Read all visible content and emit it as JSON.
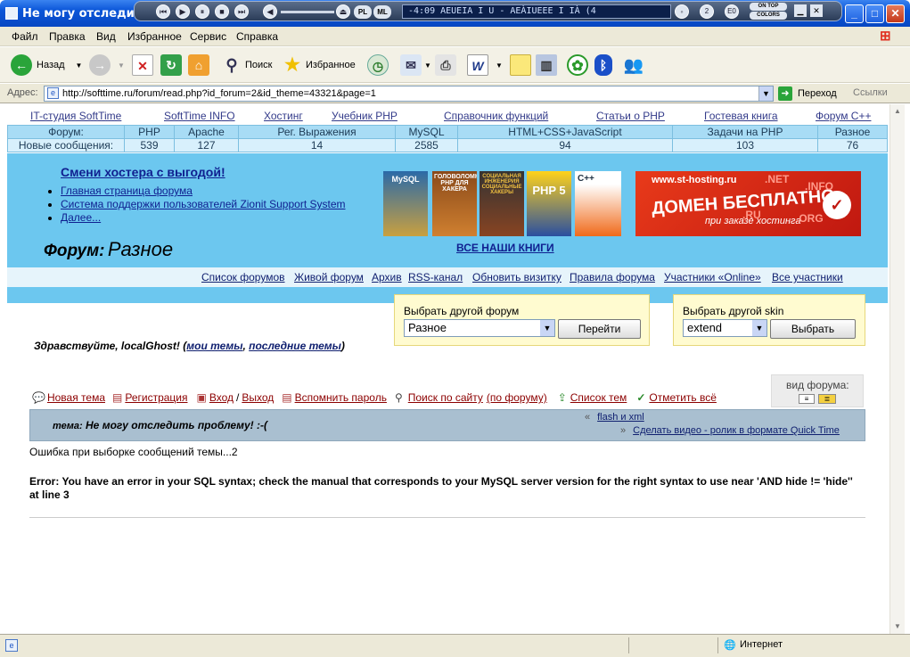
{
  "window": {
    "title": "Не могу отследить",
    "min": "_",
    "max": "□",
    "close": "✕"
  },
  "media": {
    "track": "-4:09   AEUEIA   I U -  AEÀIUEEE  I IÀ (4",
    "ontop": "ON TOP",
    "colors": "COLORS",
    "pl": "PL",
    "ml": "ML",
    "eq": "E0",
    "badge": "2"
  },
  "menu": [
    "Файл",
    "Правка",
    "Вид",
    "Избранное",
    "Сервис",
    "Справка"
  ],
  "toolbar": {
    "back": "Назад",
    "search": "Поиск",
    "favorites": "Избранное"
  },
  "address": {
    "label": "Адрес:",
    "url": "http://softtime.ru/forum/read.php?id_forum=2&id_theme=43321&page=1",
    "go": "Переход",
    "links": "Ссылки"
  },
  "toplinks": [
    "IT-студия SoftTime",
    "SoftTime INFO",
    "Хостинг",
    "Учебник PHP",
    "Справочник функций",
    "Статьи о PHP",
    "Гостевая книга",
    "Форум С++"
  ],
  "stats": {
    "headers": [
      "Форум:",
      "PHP",
      "Apache",
      "Рег. Выражения",
      "MySQL",
      "HTML+CSS+JavaScript",
      "Задачи на PHP",
      "Разное"
    ],
    "values": [
      "Новые сообщения:",
      "539",
      "127",
      "14",
      "2585",
      "94",
      "103",
      "76"
    ]
  },
  "banner": {
    "promo": "Смени хостера с выгодой!",
    "links": [
      "Главная страница форума",
      "Система поддержки пользователей Zionit Support System",
      "Далее..."
    ],
    "forum_label": "Форум:",
    "forum_name": "Разное",
    "books_link": "ВСЕ НАШИ КНИГИ",
    "books": [
      "MySQL",
      "ГОЛОВОЛОМКИ PHP ДЛЯ ХАКЕРА",
      "СОЦИАЛЬНАЯ ИНЖЕНЕРИЯ СОЦИАЛЬНЫЕ ХАКЕРЫ",
      "PHP 5",
      "C++"
    ],
    "ad_url": "www.st-hosting.ru",
    "ad_title": "ДОМЕН БЕСПЛАТНО",
    "ad_sub": "при заказе хостинга",
    "ad_tlds": [
      ".RU",
      ".NET",
      ".ORG",
      ".INFO"
    ]
  },
  "submenu": [
    "Список форумов",
    "Живой форум",
    "Архив",
    "RSS-канал",
    "Обновить визитку",
    "Правила форума",
    "Участники «Online»",
    "Все участники"
  ],
  "forum_select": {
    "label": "Выбрать другой форум",
    "value": "Разное",
    "button": "Перейти"
  },
  "skin_select": {
    "label": "Выбрать другой skin",
    "value": "extend",
    "button": "Выбрать"
  },
  "greeting": {
    "text": "Здравствуйте, localGhost!",
    "open": "(",
    "my_topics": "мои темы",
    "comma": ",",
    "last_topics": "последние темы",
    "close": ")"
  },
  "actions": {
    "new_topic": "Новая тема",
    "register": "Регистрация",
    "login": "Вход",
    "slash": "/",
    "logout": "Выход",
    "remind": "Вспомнить пароль",
    "search": "Поиск по сайту",
    "search_forum": "(по форуму)",
    "topic_list": "Список тем",
    "mark_all": "Отметить всё",
    "view_label": "вид форума:"
  },
  "topic": {
    "label": "тема:",
    "title": "Не могу отследить проблему! :-(",
    "flash": "flash и xml",
    "video": "Сделать видео - ролик в формате Quick Time"
  },
  "messages": {
    "error1": "Ошибка при выборке сообщений темы...2",
    "error2": "Error: You have an error in your SQL syntax; check the manual that corresponds to your MySQL server version for the right syntax to use near 'AND hide != 'hide'' at line 3"
  },
  "status": {
    "zone": "Интернет"
  }
}
